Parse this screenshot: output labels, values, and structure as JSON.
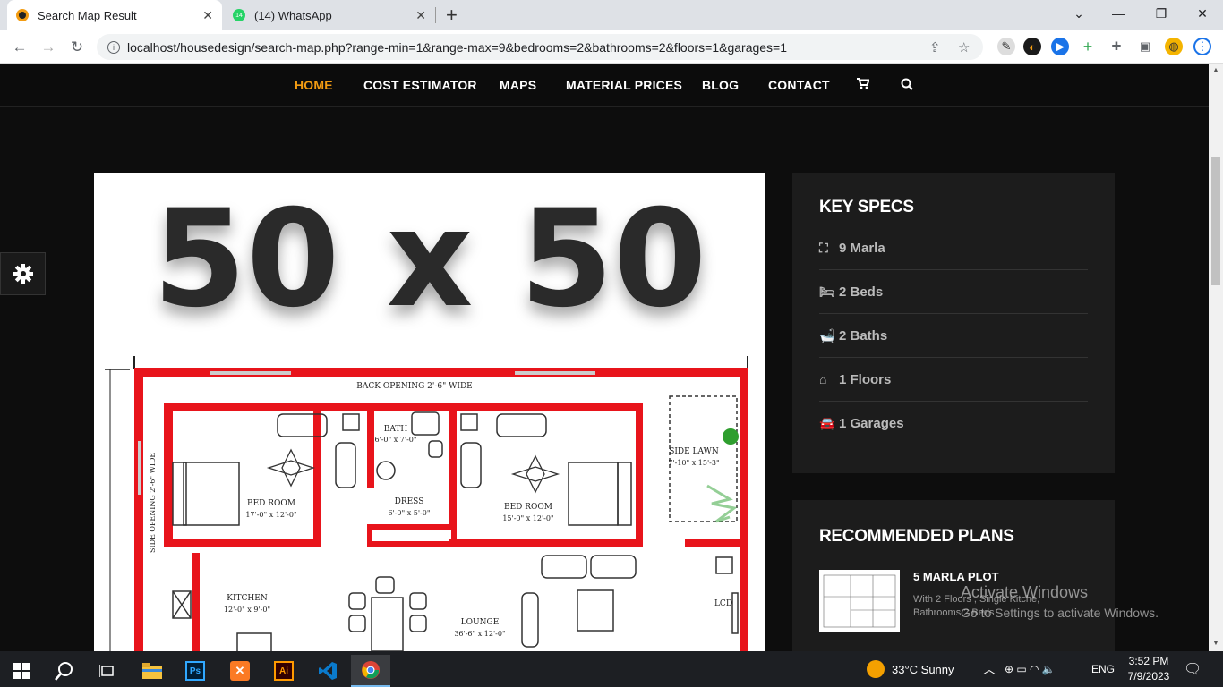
{
  "browser": {
    "tabs": [
      {
        "title": "Search Map Result",
        "active": true
      },
      {
        "title": "(14) WhatsApp",
        "active": false,
        "badge": "14"
      }
    ],
    "url": "localhost/housedesign/search-map.php?range-min=1&range-max=9&bedrooms=2&bathrooms=2&floors=1&garages=1"
  },
  "nav": {
    "items": [
      "HOME",
      "COST ESTIMATOR",
      "MAPS",
      "MATERIAL PRICES",
      "BLOG",
      "CONTACT"
    ],
    "active_color": "#f39c12"
  },
  "plan": {
    "heading": "50 x 50",
    "labels": {
      "back_opening": "BACK OPENING 2'-6\" WIDE",
      "bath": "BATH",
      "bath_size": "6'-0\" x 7'-0\"",
      "side_lawn": "SIDE LAWN",
      "side_lawn_size": "7'-10\" x 15'-3\"",
      "bedroom1": "BED ROOM",
      "bedroom1_size": "17'-0\" x 12'-0\"",
      "dress": "DRESS",
      "dress_size": "6'-0\" x 5'-0\"",
      "bedroom2": "BED ROOM",
      "bedroom2_size": "15'-0\" x 12'-0\"",
      "side_opening": "SIDE OPENING 2'-6\" WIDE",
      "kitchen": "KITCHEN",
      "kitchen_size": "12'-0\" x 9'-0\"",
      "lounge": "LOUNGE",
      "lounge_size": "36'-6\" x 12'-0\"",
      "lcd": "LCD"
    }
  },
  "specs": {
    "title": "KEY SPECS",
    "rows": [
      "9 Marla",
      "2 Beds",
      "2 Baths",
      "1 Floors",
      "1 Garages"
    ]
  },
  "recommended": {
    "title": "RECOMMENDED PLANS",
    "item": {
      "name": "5 MARLA PLOT",
      "desc": "With 2 Floors , Single Kitche, Bathrooms,2 Beds"
    }
  },
  "watermark": {
    "line1": "Activate Windows",
    "line2": "Go to Settings to activate Windows."
  },
  "taskbar": {
    "weather": "33°C  Sunny",
    "lang": "ENG",
    "time": "3:52 PM",
    "date": "7/9/2023"
  }
}
